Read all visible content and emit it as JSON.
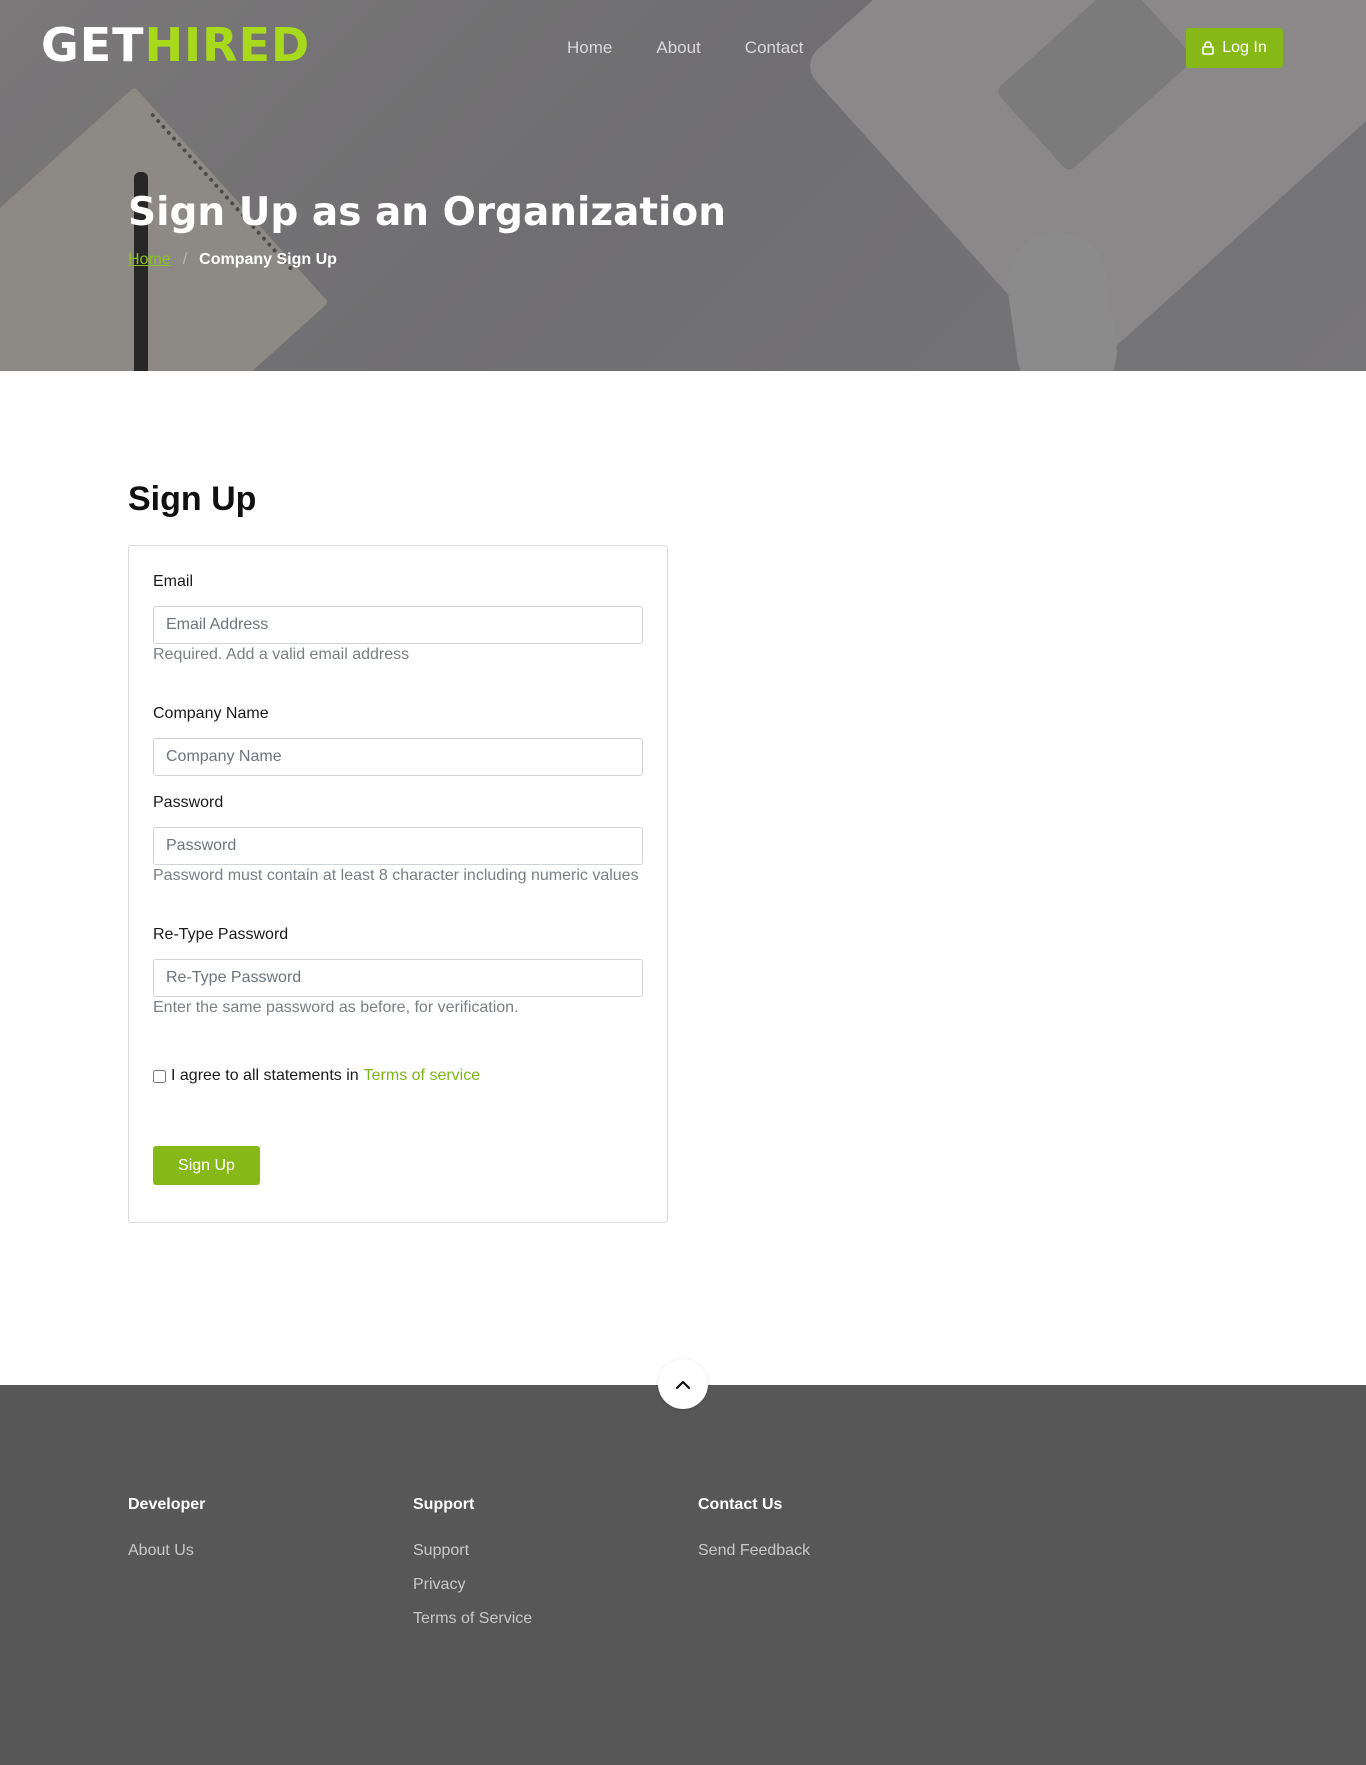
{
  "header": {
    "logo_part1": "GET",
    "logo_part2": "HIRED",
    "nav": [
      "Home",
      "About",
      "Contact"
    ],
    "login_label": "Log In",
    "title": "Sign Up as an Organization",
    "breadcrumb": {
      "home": "Home",
      "separator": "/",
      "current": "Company Sign Up"
    }
  },
  "form": {
    "title": "Sign Up",
    "email": {
      "label": "Email",
      "placeholder": "Email Address",
      "hint": "Required. Add a valid email address"
    },
    "company": {
      "label": "Company Name",
      "placeholder": "Company Name"
    },
    "password": {
      "label": "Password",
      "placeholder": "Password",
      "hint": "Password must contain at least 8 character including numeric values"
    },
    "retype": {
      "label": "Re-Type Password",
      "placeholder": "Re-Type Password",
      "hint": "Enter the same password as before, for verification."
    },
    "agree_text": "I agree to all statements in",
    "terms_link": "Terms of service",
    "submit_label": "Sign Up"
  },
  "footer": {
    "columns": [
      {
        "title": "Developer",
        "links": [
          "About Us"
        ]
      },
      {
        "title": "Support",
        "links": [
          "Support",
          "Privacy",
          "Terms of Service"
        ]
      },
      {
        "title": "Contact Us",
        "links": [
          "Send Feedback"
        ]
      }
    ]
  },
  "colors": {
    "accent": "#86b817",
    "logo_accent": "#a8d91b",
    "footer_bg": "#575757"
  },
  "icons": [
    "lock-icon",
    "chevron-up-icon"
  ]
}
